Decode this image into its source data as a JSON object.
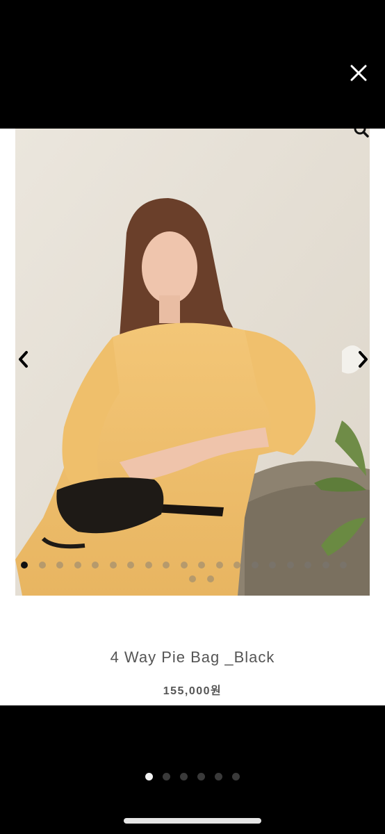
{
  "viewer": {
    "close_icon": "close-icon",
    "zoom_icon": "zoom-icon",
    "prev_icon": "chevron-left-icon",
    "next_icon": "chevron-right-icon"
  },
  "product": {
    "title": "4 Way Pie Bag _Black",
    "price": "155,000원",
    "image": "model-in-yellow-shirt-dress-holding-black-bag"
  },
  "photo_carousel": {
    "total": 21,
    "active_index": 0
  },
  "gallery_pager": {
    "total": 6,
    "active_index": 0
  },
  "colors": {
    "background": "#000000",
    "card": "#ffffff",
    "text": "#555555",
    "active_dot": "#111111"
  }
}
